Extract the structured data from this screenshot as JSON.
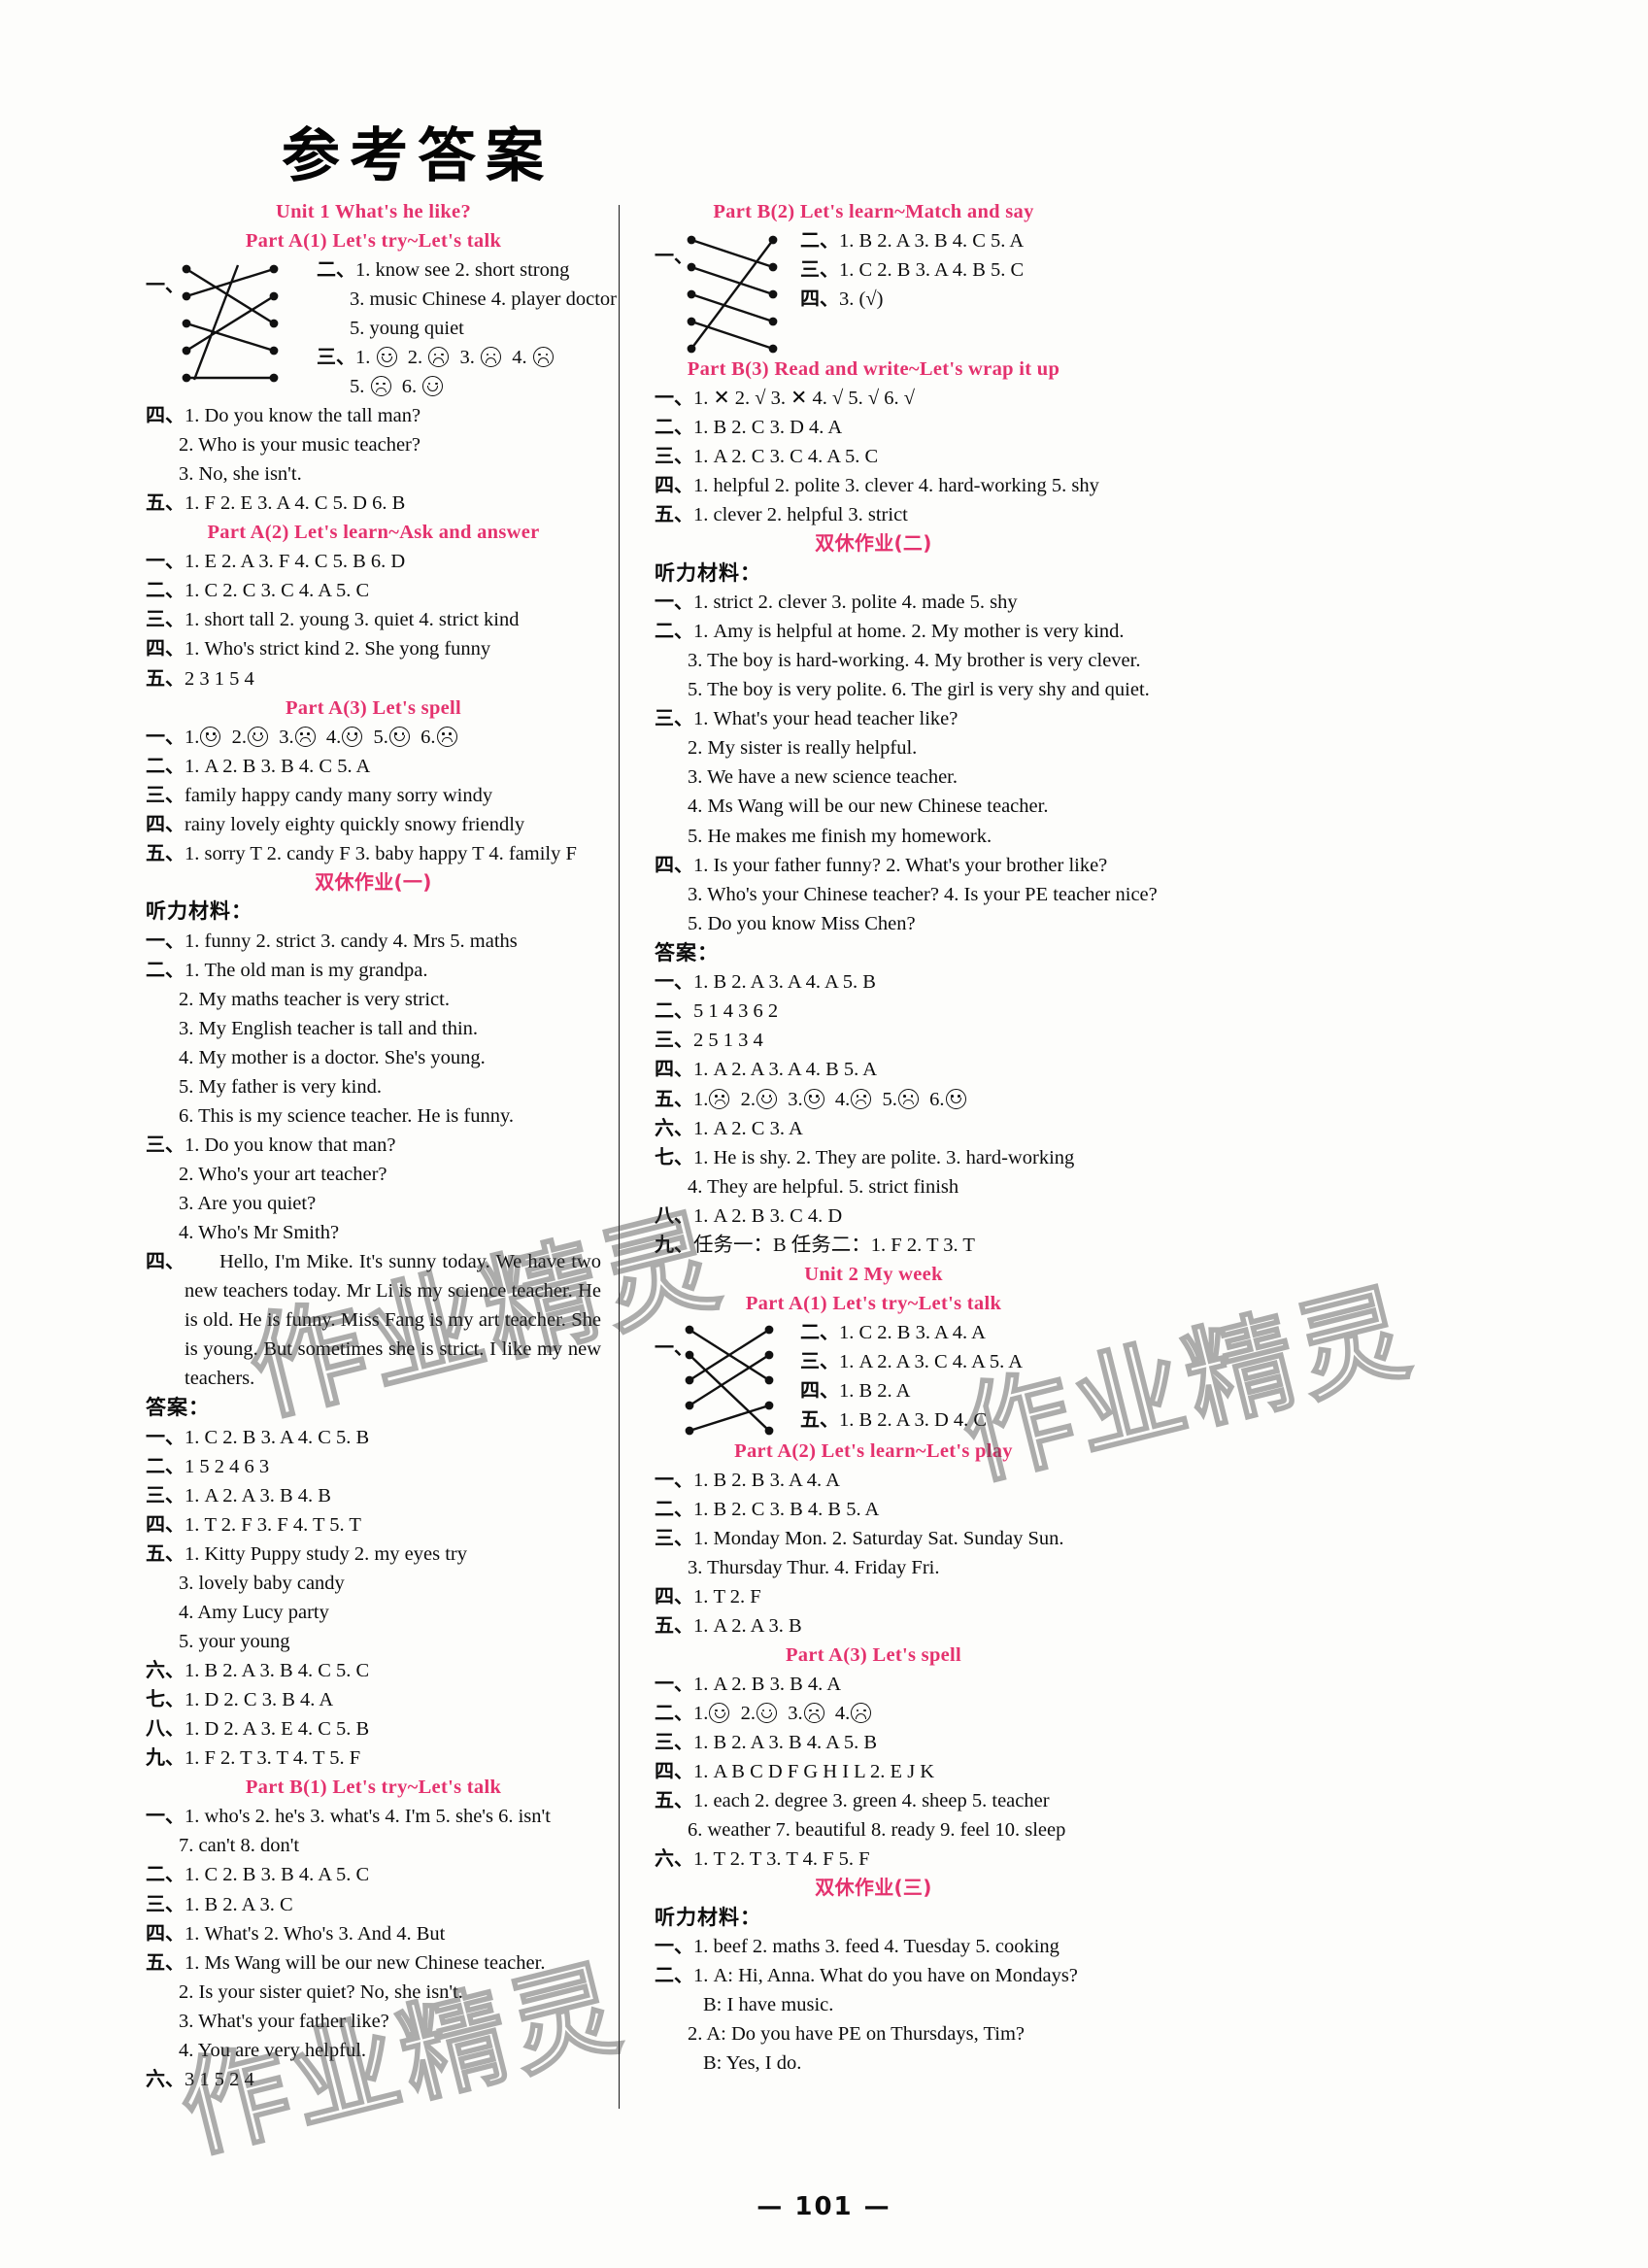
{
  "page": {
    "title": "参考答案",
    "page_number": "— 101 —",
    "watermarks": [
      "作业精灵",
      "作业精灵",
      "作业精灵"
    ]
  },
  "left_column": {
    "unit_header": "Unit 1    What's he like?",
    "sections": [
      {
        "header": "Part A(1)    Let's try~Let's talk",
        "has_match_diagram": true,
        "match_label": "一、",
        "lines": [
          {
            "label": "二、",
            "text": "1. know   see  2. short   strong"
          },
          {
            "label": "",
            "text": "3. music  Chinese  4. player   doctor",
            "indent": 1
          },
          {
            "label": "",
            "text": "5. young   quiet",
            "indent": 1
          },
          {
            "label": "三、",
            "faces": "1. :) 2. :( 3. :( 4. :("
          },
          {
            "label": "",
            "faces2": "5. :( 6. :)",
            "indent": 1
          },
          {
            "label": "四、",
            "text": "1. Do you know the tall man?"
          },
          {
            "label": "",
            "text": "2. Who is your music teacher?",
            "indent": 1
          },
          {
            "label": "",
            "text": "3. No, she isn't.",
            "indent": 1
          },
          {
            "label": "五、",
            "text": "1. F  2. E   3. A   4. C   5. D   6. B"
          }
        ]
      },
      {
        "header": "Part A(2)    Let's learn~Ask and answer",
        "lines": [
          {
            "label": "一、",
            "text": "1. E   2. A   3. F   4. C   5. B   6. D"
          },
          {
            "label": "二、",
            "text": "1. C   2. C   3. C   4. A   5. C"
          },
          {
            "label": "三、",
            "text": "1. short   tall  2. young   3. quiet   4. strict   kind"
          },
          {
            "label": "四、",
            "text": "1. Who's   strict   kind    2. She  yong  funny"
          },
          {
            "label": "五、",
            "text": "2   3   1   5   4"
          }
        ]
      },
      {
        "header": "Part A(3)    Let's spell",
        "lines": [
          {
            "label": "一、",
            "faces": "1.:) 2.:) 3.:( 4.:) 5.:) 6.:("
          },
          {
            "label": "二、",
            "text": "1. A  2. B  3. B  4. C  5. A"
          },
          {
            "label": "三、",
            "text": "family   happy   candy   many   sorry   windy"
          },
          {
            "label": "四、",
            "text": "rainy   lovely   eighty   quickly   snowy   friendly"
          },
          {
            "label": "五、",
            "text": "1. sorry   T   2. candy   F   3. baby happy   T   4. family   F"
          }
        ]
      },
      {
        "header": "双休作业(一)",
        "is_chinese_header": true,
        "sub_label": "听力材料：",
        "lines": [
          {
            "label": "一、",
            "text": "1. funny  2. strict  3. candy  4. Mrs  5. maths"
          },
          {
            "label": "二、",
            "text": "1. The old man is my grandpa."
          },
          {
            "label": "",
            "text": "2. My maths teacher is very strict.",
            "indent": 1
          },
          {
            "label": "",
            "text": "3. My English teacher is tall and thin.",
            "indent": 1
          },
          {
            "label": "",
            "text": "4. My mother is a doctor.  She's young.",
            "indent": 1
          },
          {
            "label": "",
            "text": "5. My father is very kind.",
            "indent": 1
          },
          {
            "label": "",
            "text": "6. This is my science teacher.  He is funny.",
            "indent": 1
          },
          {
            "label": "三、",
            "text": "1. Do you know that man?"
          },
          {
            "label": "",
            "text": "2. Who's your art teacher?",
            "indent": 1
          },
          {
            "label": "",
            "text": "3. Are you quiet?",
            "indent": 1
          },
          {
            "label": "",
            "text": "4. Who's Mr Smith?",
            "indent": 1
          },
          {
            "label": "四、",
            "paragraph": "Hello, I'm Mike. It's sunny today. We have two new teachers today. Mr Li is my science teacher. He is old. He is funny. Miss Fang is my art teacher. She is young. But sometimes she is strict. I like my new teachers."
          }
        ],
        "answer_label": "答案：",
        "answers": [
          {
            "label": "一、",
            "text": "1. C  2. B  3. A   4. C   5. B"
          },
          {
            "label": "二、",
            "text": "1  5   2   4   6   3"
          },
          {
            "label": "三、",
            "text": "1. A   2. A   3. B   4. B"
          },
          {
            "label": "四、",
            "text": "1. T   2. F   3. F   4. T   5. T"
          },
          {
            "label": "五、",
            "text": "1. Kitty  Puppy  study  2. my  eyes  try"
          },
          {
            "label": "",
            "text": "3. lovely  baby  candy",
            "indent": 1
          },
          {
            "label": "",
            "text": "4. Amy  Lucy  party",
            "indent": 1
          },
          {
            "label": "",
            "text": "5. your  young",
            "indent": 1
          },
          {
            "label": "六、",
            "text": "1. B   2. A   3. B   4. C   5. C"
          },
          {
            "label": "七、",
            "text": "1. D   2. C   3. B   4. A"
          },
          {
            "label": "八、",
            "text": "1. D   2. A   3. E   4. C   5. B"
          },
          {
            "label": "九、",
            "text": "1. F   2. T   3. T   4. T   5. F"
          }
        ]
      },
      {
        "header": "Part B(1)    Let's try~Let's talk",
        "lines": [
          {
            "label": "一、",
            "text": "1. who's  2. he's  3. what's  4. I'm  5. she's  6. isn't"
          },
          {
            "label": "",
            "text": "7. can't  8. don't",
            "indent": 1
          },
          {
            "label": "二、",
            "text": "1. C   2. B   3. B   4. A   5. C"
          },
          {
            "label": "三、",
            "text": "1. B   2. A   3. C"
          },
          {
            "label": "四、",
            "text": "1. What's   2. Who's   3. And   4. But"
          },
          {
            "label": "五、",
            "text": "1. Ms Wang will be our new Chinese teacher."
          },
          {
            "label": "",
            "text": "2. Is your sister quiet?     No, she isn't.",
            "indent": 1
          },
          {
            "label": "",
            "text": "3. What's your father like?",
            "indent": 1
          },
          {
            "label": "",
            "text": "4. You are very helpful.",
            "indent": 1
          },
          {
            "label": "六、",
            "text": "3   1   5   2   4"
          }
        ]
      }
    ]
  },
  "right_column": {
    "sections": [
      {
        "header": "Part B(2)    Let's learn~Match and say",
        "has_match_diagram": true,
        "match_label": "一、",
        "lines": [
          {
            "label": "二、",
            "text": "1. B  2. A  3. B  4. C  5. A"
          },
          {
            "label": "三、",
            "text": "1. C  2. B  3. A  4. B  5. C"
          },
          {
            "label": "四、",
            "text": "3. (√)"
          }
        ]
      },
      {
        "header": "Part B(3)    Read and write~Let's wrap it up",
        "lines": [
          {
            "label": "一、",
            "text": "1. ✕   2. √   3. ✕   4. √   5. √   6. √"
          },
          {
            "label": "二、",
            "text": "1. B   2. C   3. D   4. A"
          },
          {
            "label": "三、",
            "text": "1. A   2. C   3. C   4. A   5. C"
          },
          {
            "label": "四、",
            "text": "1. helpful   2. polite   3. clever   4. hard-working   5. shy"
          },
          {
            "label": "五、",
            "text": "1. clever   2. helpful   3. strict"
          }
        ]
      },
      {
        "header": "双休作业(二)",
        "is_chinese_header": true,
        "sub_label": "听力材料：",
        "lines": [
          {
            "label": "一、",
            "text": "1. strict   2. clever   3. polite   4. made   5. shy"
          },
          {
            "label": "二、",
            "text": "1. Amy is helpful at home.   2. My mother is very kind."
          },
          {
            "label": "",
            "text": "3. The boy is hard-working.    4. My brother is very clever.",
            "indent": 1
          },
          {
            "label": "",
            "text": "5. The boy is very polite.   6. The girl is very shy and quiet.",
            "indent": 1
          },
          {
            "label": "三、",
            "text": "1. What's your head teacher like?"
          },
          {
            "label": "",
            "text": "2. My sister is really helpful.",
            "indent": 1
          },
          {
            "label": "",
            "text": "3. We have a new science teacher.",
            "indent": 1
          },
          {
            "label": "",
            "text": "4. Ms Wang will be our new Chinese teacher.",
            "indent": 1
          },
          {
            "label": "",
            "text": "5. He makes me finish my homework.",
            "indent": 1
          },
          {
            "label": "四、",
            "text": "1. Is your father funny?    2. What's your brother like?"
          },
          {
            "label": "",
            "text": "3. Who's your Chinese teacher?    4. Is your PE teacher nice?",
            "indent": 1
          },
          {
            "label": "",
            "text": "5. Do you know Miss Chen?",
            "indent": 1
          }
        ],
        "answer_label": "答案：",
        "answers": [
          {
            "label": "一、",
            "text": "1. B  2. A  3. A  4. A  5. B"
          },
          {
            "label": "二、",
            "text": "5   1   4   3   6   2"
          },
          {
            "label": "三、",
            "text": "2   5   1   3   4"
          },
          {
            "label": "四、",
            "text": "1. A  2. A  3. A  4. B  5. A"
          },
          {
            "label": "五、",
            "faces": "1.:( 2.:) 3.:) 4.:( 5.:( 6.:)"
          },
          {
            "label": "六、",
            "text": "1. A   2. C   3. A"
          },
          {
            "label": "七、",
            "text": "1. He is shy.   2. They are polite.   3. hard-working"
          },
          {
            "label": "",
            "text": "4. They are helpful.  5. strict  finish",
            "indent": 1
          },
          {
            "label": "八、",
            "text": "1. A  2. B  3. C  4. D"
          },
          {
            "label": "九、",
            "text": "任务一：B     任务二：1. F  2. T  3. T"
          }
        ]
      },
      {
        "unit_header": "Unit 2    My week",
        "header": "Part A(1)    Let's try~Let's talk",
        "has_match_diagram": true,
        "match_label": "一、",
        "lines": [
          {
            "label": "二、",
            "text": "1. C  2. B  3. A  4. A"
          },
          {
            "label": "三、",
            "text": "1. A  2. A  3. C  4. A  5. A"
          },
          {
            "label": "四、",
            "text": "1. B  2. A"
          },
          {
            "label": "五、",
            "text": "1. B  2. A  3. D  4. C"
          }
        ]
      },
      {
        "header": "Part A(2)    Let's learn~Let's play",
        "lines": [
          {
            "label": "一、",
            "text": "1. B  2. B  3. A  4. A"
          },
          {
            "label": "二、",
            "text": "1. B  2. C  3. B  4. B  5. A"
          },
          {
            "label": "三、",
            "text": "1. Monday  Mon.    2. Saturday  Sat.   Sunday  Sun."
          },
          {
            "label": "",
            "text": "3. Thursday  Thur.    4. Friday  Fri.",
            "indent": 1
          },
          {
            "label": "四、",
            "text": "1. T   2. F"
          },
          {
            "label": "五、",
            "text": "1. A   2. A   3. B"
          }
        ]
      },
      {
        "header": "Part A(3)    Let's spell",
        "lines": [
          {
            "label": "一、",
            "text": "1. A   2. B   3. B   4. A"
          },
          {
            "label": "二、",
            "faces": "1.:) 2.:) 3.:( 4.:("
          },
          {
            "label": "三、",
            "text": "1. B   2. A   3. B   4. A   5. B"
          },
          {
            "label": "四、",
            "text": "1. A B C D F G H I L 2. E J K"
          },
          {
            "label": "五、",
            "text": "1. each   2. degree   3. green   4. sheep   5. teacher"
          },
          {
            "label": "",
            "text": "6. weather   7. beautiful   8. ready   9. feel   10. sleep",
            "indent": 1
          },
          {
            "label": "六、",
            "text": "1. T   2. T   3. T   4. F   5. F"
          }
        ]
      },
      {
        "header": "双休作业(三)",
        "is_chinese_header": true,
        "sub_label": "听力材料：",
        "lines": [
          {
            "label": "一、",
            "text": "1. beef  2. maths  3. feed  4. Tuesday  5. cooking"
          },
          {
            "label": "二、",
            "text": "1. A: Hi, Anna. What do you have on Mondays?"
          },
          {
            "label": "",
            "text": "B: I have music.",
            "indent": 2
          },
          {
            "label": "",
            "text": "2. A: Do you have PE on Thursdays, Tim?",
            "indent": 1
          },
          {
            "label": "",
            "text": "B: Yes, I do.",
            "indent": 2
          }
        ]
      }
    ]
  }
}
